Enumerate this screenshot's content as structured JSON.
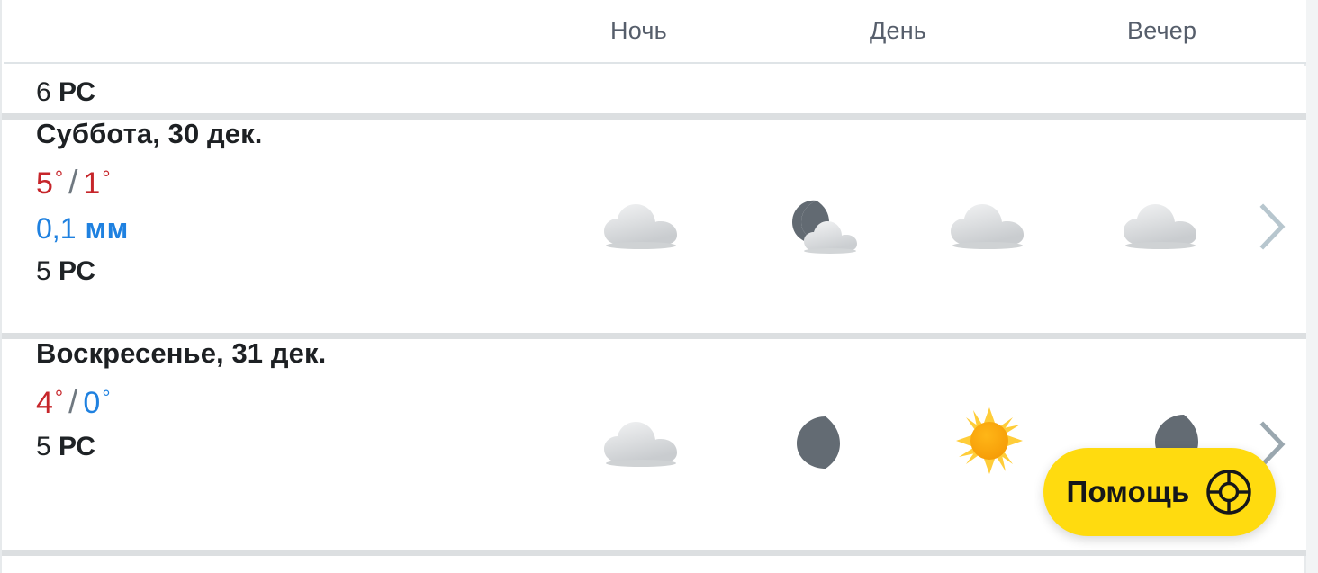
{
  "header": {
    "columns": [
      {
        "label": "Ночь",
        "name": "column-night"
      },
      {
        "label": "День",
        "name": "column-day"
      },
      {
        "label": "Вечер",
        "name": "column-evening"
      }
    ]
  },
  "partial_row": {
    "wind_value": "6",
    "wind_unit": "РС"
  },
  "days": [
    {
      "title": "Суббота, 30 дек.",
      "temp_high": "5",
      "temp_low": "1",
      "temp_high_color": "#c6252a",
      "temp_low_color": "#c6252a",
      "degree": "°",
      "separator": "/",
      "precip_value": "0,1",
      "precip_unit": "мм",
      "precip_color": "#1f81e0",
      "wind_value": "5",
      "wind_unit": "РС",
      "icons": [
        "cloud-icon",
        "moon-cloud-icon",
        "cloud-icon",
        "cloud-icon"
      ],
      "chevron": "chevron-right-icon"
    },
    {
      "title": "Воскресенье, 31 дек.",
      "temp_high": "4",
      "temp_low": "0",
      "temp_high_color": "#c6252a",
      "temp_low_color": "#1f81e0",
      "degree": "°",
      "separator": "/",
      "precip_value": "",
      "precip_unit": "",
      "precip_color": "#1f81e0",
      "wind_value": "5",
      "wind_unit": "РС",
      "icons": [
        "cloud-icon",
        "moon-icon",
        "sun-icon",
        "moon-icon"
      ],
      "chevron": "chevron-right-icon"
    }
  ],
  "help_button": {
    "label": "Помощь",
    "icon": "life-ring-icon",
    "background": "#ffdb0f",
    "text_color": "#15171a"
  },
  "colors": {
    "page_background": "#ffffff",
    "separator": "#dcdfe1",
    "header_text": "#565e6b",
    "body_text": "#1d2023",
    "chevron": "#b7c6ce"
  }
}
